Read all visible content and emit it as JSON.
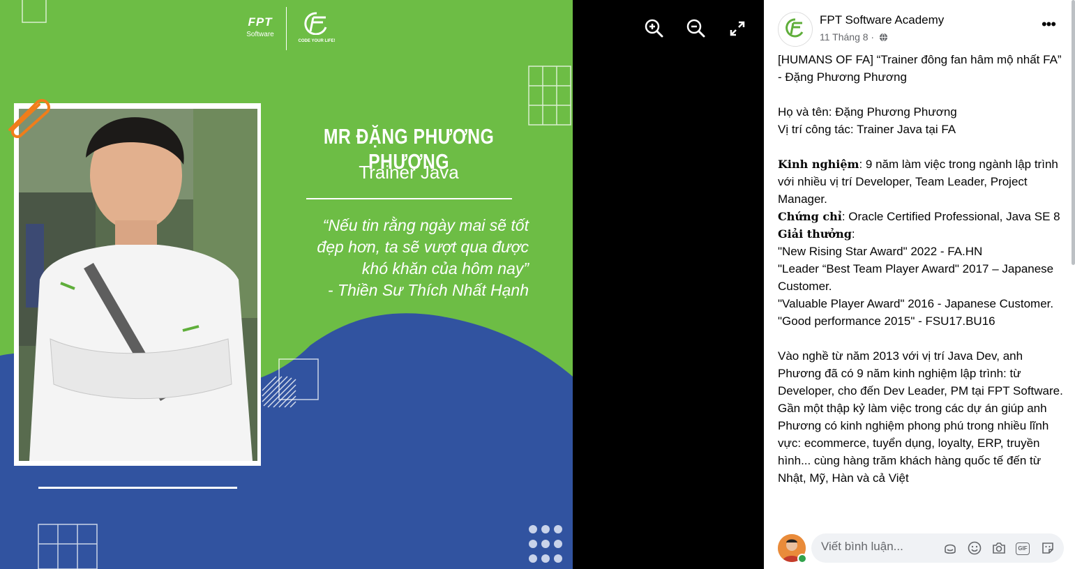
{
  "poster": {
    "brand_mark": "FPT",
    "brand_sub": "Software",
    "slogan": "CODE YOUR LIFE!",
    "name": "MR ĐẶNG PHƯƠNG PHƯƠNG",
    "role": "Trainer Java",
    "quote_lines": [
      "“Nếu tin rằng ngày mai sẽ tốt",
      "đẹp hơn, ta sẽ vượt qua được",
      "khó khăn của hôm nay”",
      "- Thiền Sư Thích Nhất Hạnh"
    ]
  },
  "viewer_tools": {
    "zoom_in": "zoom-in-icon",
    "zoom_out": "zoom-out-icon",
    "fullscreen": "fullscreen-icon"
  },
  "post": {
    "page_name": "FPT Software Academy",
    "date": "11 Tháng 8 ·",
    "privacy_icon": "globe-icon",
    "more_label": "•••",
    "title": "[HUMANS OF FA] “Trainer đông fan hâm mộ nhất FA” - Đặng Phương Phương",
    "fullname": "Họ và tên: Đặng Phương Phương",
    "position": "Vị trí công tác: Trainer Java tại FA",
    "experience_label": "Kinh nghiệm",
    "experience_text": ": 9 năm làm việc trong ngành lập trình với nhiều vị trí Developer, Team Leader, Project Manager.",
    "cert_label": "Chứng chỉ",
    "cert_text": ": Oracle Certified Professional, Java SE 8",
    "awards_label": "Giải thưởng",
    "awards_colon": ":",
    "awards": [
      "\"New Rising Star Award\" 2022 - FA.HN",
      "\"Leader “Best Team Player Award\" 2017 – Japanese Customer.",
      "\"Valuable Player Award\" 2016 - Japanese Customer.",
      "\"Good performance 2015\" - FSU17.BU16"
    ],
    "story": "Vào nghề từ năm 2013 với vị trí Java Dev, anh Phương đã có 9 năm kinh nghiệm lập trình: từ Developer, cho đến Dev Leader, PM tại FPT Software. Gần một thập kỷ làm việc trong các dự án giúp anh Phương có kinh nghiệm phong phú trong nhiều lĩnh vực: ecommerce, tuyển dụng, loyalty, ERP, truyền hình... cùng hàng trăm khách hàng quốc tế đến từ Nhật, Mỹ, Hàn và cả Việt"
  },
  "comment": {
    "placeholder": "Viết bình luận...",
    "icons": [
      "avatar-sticker-icon",
      "emoji-icon",
      "camera-icon",
      "gif-icon",
      "sticker-icon"
    ],
    "gif_label": "GIF"
  },
  "colors": {
    "poster_green": "#6dbd45",
    "poster_blue": "#3153a0",
    "accent_orange": "#f07d1a",
    "online_green": "#31a24c"
  }
}
